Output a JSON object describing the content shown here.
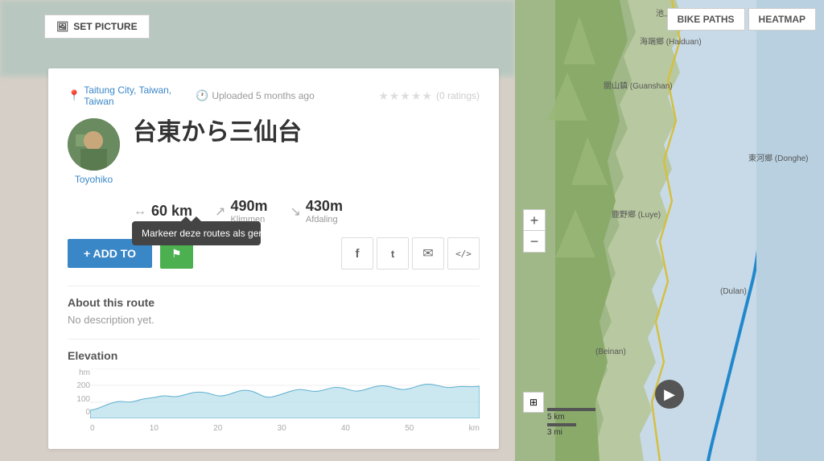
{
  "set_picture": {
    "label": "SET PICTURE"
  },
  "card": {
    "location": {
      "city": "Taitung City, Taiwan,",
      "country": "Taiwan"
    },
    "uploaded": "Uploaded 5 months ago",
    "ratings": "(0 ratings)",
    "route_title": "台東から三仙台",
    "avatar_user": "Toyohiko",
    "stats": {
      "distance": {
        "value": "60 km",
        "label": ""
      },
      "climb": {
        "value": "490m",
        "label": "Klimmen"
      },
      "descent": {
        "value": "430m",
        "label": "Afdaling"
      }
    },
    "tooltip": {
      "text": "Markeer deze routes als gereden"
    },
    "actions": {
      "add_to": "+ ADD TO",
      "flag": "⚑"
    },
    "social": {
      "facebook": "f",
      "twitter": "t",
      "email": "✉",
      "embed": "</>"
    },
    "about": {
      "title": "About this route",
      "description": "No description yet."
    },
    "elevation": {
      "title": "Elevation",
      "y_labels": [
        "hm",
        "200",
        "100",
        "0"
      ],
      "x_labels": [
        "0",
        "10",
        "20",
        "30",
        "40",
        "50",
        "km"
      ]
    }
  },
  "map": {
    "bike_paths_label": "BIKE PATHS",
    "heatmap_label": "HEATMAP",
    "zoom_in": "+",
    "zoom_out": "−",
    "scale_km": "5 km",
    "scale_mi": "3 mi"
  }
}
